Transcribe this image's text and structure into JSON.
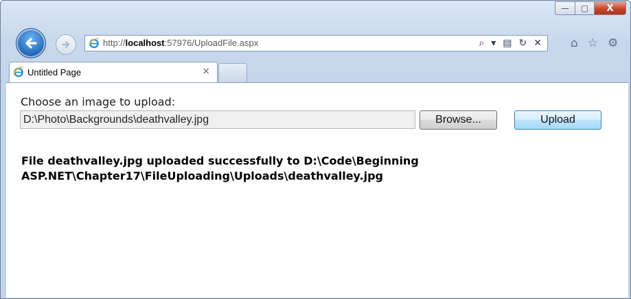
{
  "browser": {
    "url_prefix": "http://",
    "url_host": "localhost",
    "url_rest": ":57976/UploadFile.aspx",
    "window_controls": {
      "minimize": "—",
      "maximize": "▢",
      "close": "X"
    },
    "address_icons": [
      "search-icon",
      "dropdown-icon",
      "compatibility-icon",
      "refresh-icon",
      "stop-icon"
    ],
    "toolbar_icons": [
      "home-icon",
      "favorites-icon",
      "tools-icon"
    ]
  },
  "tab": {
    "title": "Untitled Page",
    "close": "×"
  },
  "page": {
    "choose_label": "Choose an image to upload:",
    "file_path": "D:\\Photo\\Backgrounds\\deathvalley.jpg",
    "browse_label": "Browse...",
    "upload_label": "Upload",
    "result_message": "File deathvalley.jpg uploaded successfully to D:\\Code\\Beginning ASP.NET\\Chapter17\\FileUploading\\Uploads\\deathvalley.jpg"
  }
}
